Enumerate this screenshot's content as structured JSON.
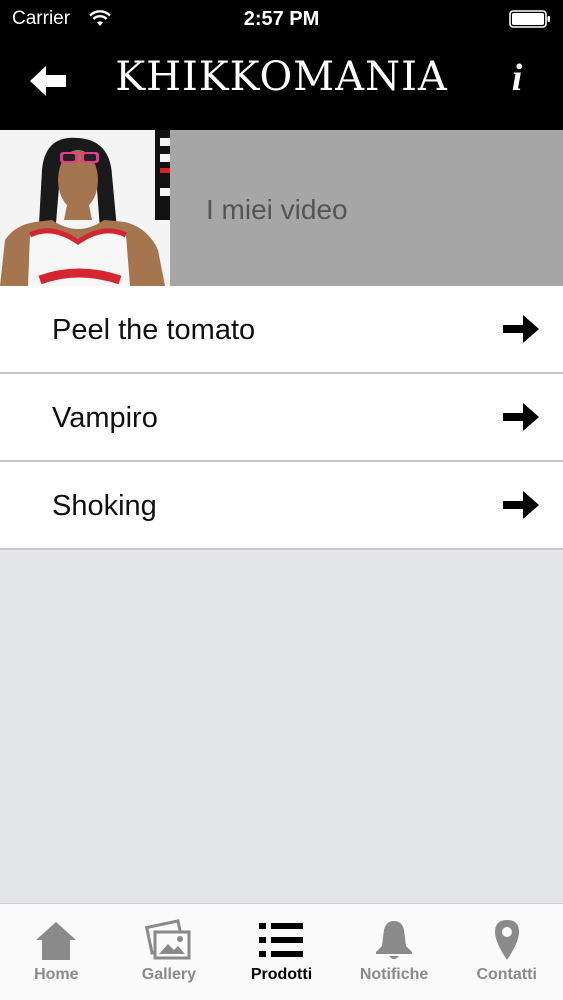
{
  "status_bar": {
    "carrier": "Carrier",
    "time": "2:57 PM"
  },
  "header": {
    "title": "KHIKKOMANIA",
    "back_icon": "arrow-left-icon",
    "info_label": "i"
  },
  "banner": {
    "section_title": "I miei video",
    "panel_color": "#a6a6a6"
  },
  "list": {
    "items": [
      {
        "label": "Peel the tomato",
        "icon": "arrow-right-icon"
      },
      {
        "label": "Vampiro",
        "icon": "arrow-right-icon"
      },
      {
        "label": "Shoking",
        "icon": "arrow-right-icon"
      }
    ]
  },
  "tabbar": {
    "active_color": "#000000",
    "inactive_color": "#8a8a8a",
    "tabs": [
      {
        "label": "Home",
        "icon": "home-icon",
        "active": false
      },
      {
        "label": "Gallery",
        "icon": "gallery-icon",
        "active": false
      },
      {
        "label": "Prodotti",
        "icon": "list-icon",
        "active": true
      },
      {
        "label": "Notifiche",
        "icon": "bell-icon",
        "active": false
      },
      {
        "label": "Contatti",
        "icon": "location-pin-icon",
        "active": false
      }
    ]
  }
}
